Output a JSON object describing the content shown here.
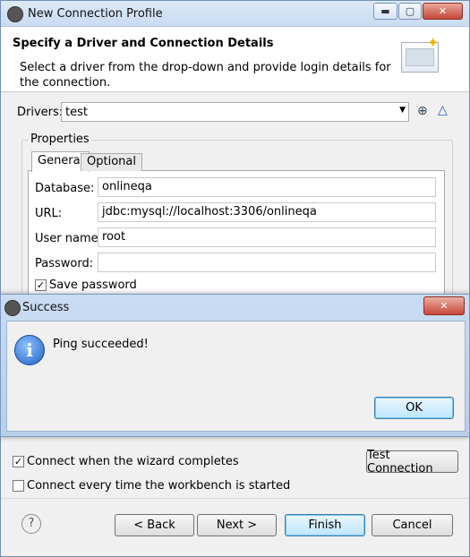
{
  "main_window": {
    "title": "New Connection Profile",
    "controls": {
      "minimize": "▬",
      "maximize": "▢",
      "close": "✕"
    },
    "header": {
      "title": "Specify a Driver and Connection Details",
      "description": "Select a driver from the drop-down and provide login details for the connection."
    },
    "drivers": {
      "label": "Drivers:",
      "selected": "test"
    },
    "properties": {
      "group_label": "Properties",
      "tabs": [
        "General",
        "Optional"
      ],
      "fields": [
        {
          "label": "Database:",
          "value": "onlineqa"
        },
        {
          "label": "URL:",
          "value": "jdbc:mysql://localhost:3306/onlineqa"
        },
        {
          "label": "User name:",
          "value": "root"
        },
        {
          "label": "Password:",
          "value": ""
        }
      ],
      "save_password": {
        "label": "Save password",
        "checked": true
      }
    },
    "connect_on_complete": {
      "label": "Connect when the wizard completes",
      "checked": true
    },
    "connect_on_start": {
      "label": "Connect every time the workbench is started",
      "checked": false
    },
    "test_connection": "Test Connection",
    "buttons": {
      "back": "< Back",
      "next": "Next >",
      "finish": "Finish",
      "cancel": "Cancel"
    }
  },
  "success_dialog": {
    "title": "Success",
    "message": "Ping succeeded!",
    "ok": "OK"
  }
}
